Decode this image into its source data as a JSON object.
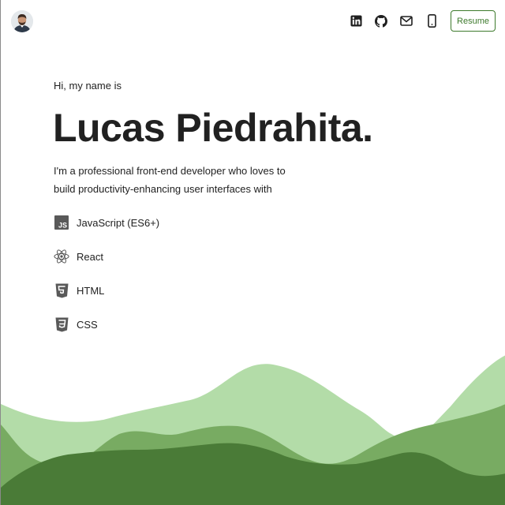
{
  "header": {
    "avatar_alt": "Profile photo",
    "nav_icons": [
      "linkedin-icon",
      "github-icon",
      "mail-icon",
      "phone-icon"
    ],
    "resume_label": "Resume"
  },
  "hero": {
    "greeting": "Hi, my name is",
    "name": "Lucas Piedrahita.",
    "description": "I'm a professional front-end developer who loves to build productivity-enhancing user interfaces with"
  },
  "technologies": [
    {
      "label": "JavaScript (ES6+)",
      "icon": "javascript-icon"
    },
    {
      "label": "React",
      "icon": "react-icon"
    },
    {
      "label": "HTML",
      "icon": "html5-icon"
    },
    {
      "label": "CSS",
      "icon": "css3-icon"
    }
  ],
  "colors": {
    "accent": "#3d7a2c",
    "wave_light": "#b3dca8",
    "wave_mid": "#78ab62",
    "wave_dark": "#4a7b37",
    "icon_gray": "#555555"
  }
}
